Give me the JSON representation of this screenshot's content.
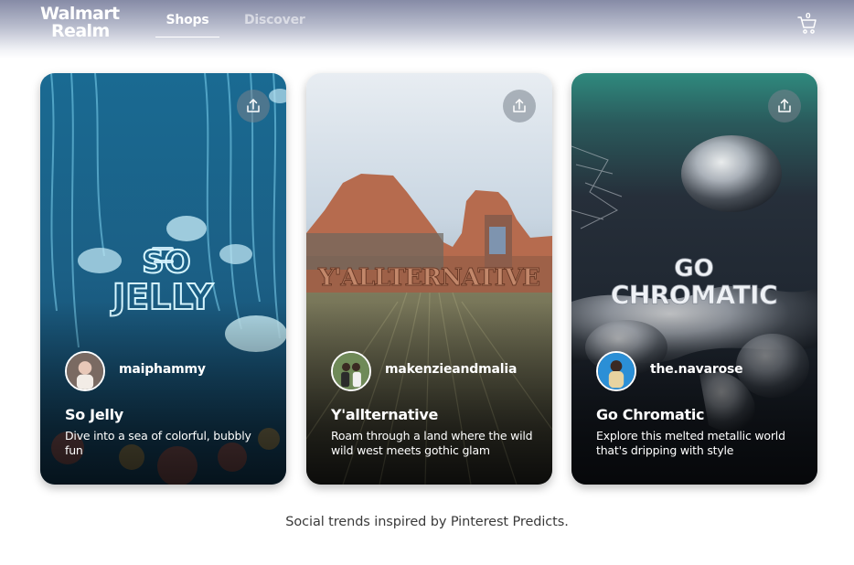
{
  "header": {
    "logo_line1": "Walmart",
    "logo_line2": "Realm",
    "tabs": [
      {
        "label": "Shops",
        "active": true
      },
      {
        "label": "Discover",
        "active": false
      }
    ],
    "cart_count": "0"
  },
  "cards": [
    {
      "username": "maiphammy",
      "title": "So Jelly",
      "description": "Dive into a sea of colorful, bubbly fun",
      "art_text_1": "SO",
      "art_text_2": "JELLY",
      "icon": "share-icon"
    },
    {
      "username": "makenzieandmalia",
      "title": "Y'allternative",
      "description": "Roam through a land where the wild wild west meets gothic glam",
      "art_text_1": "Y'ALLTERNATIVE",
      "icon": "share-icon"
    },
    {
      "username": "the.navarose",
      "title": "Go Chromatic",
      "description": "Explore this melted metallic world that's dripping with style",
      "art_text_1": "GO",
      "art_text_2": "CHROMATIC",
      "icon": "share-icon"
    }
  ],
  "footer": {
    "note": "Social trends inspired by Pinterest Predicts."
  },
  "colors": {
    "header_top": "#868ba6",
    "jelly_bg": "#1a5f86",
    "desert_sky": "#dfe6ee",
    "chrome_bg": "#1e2530"
  }
}
